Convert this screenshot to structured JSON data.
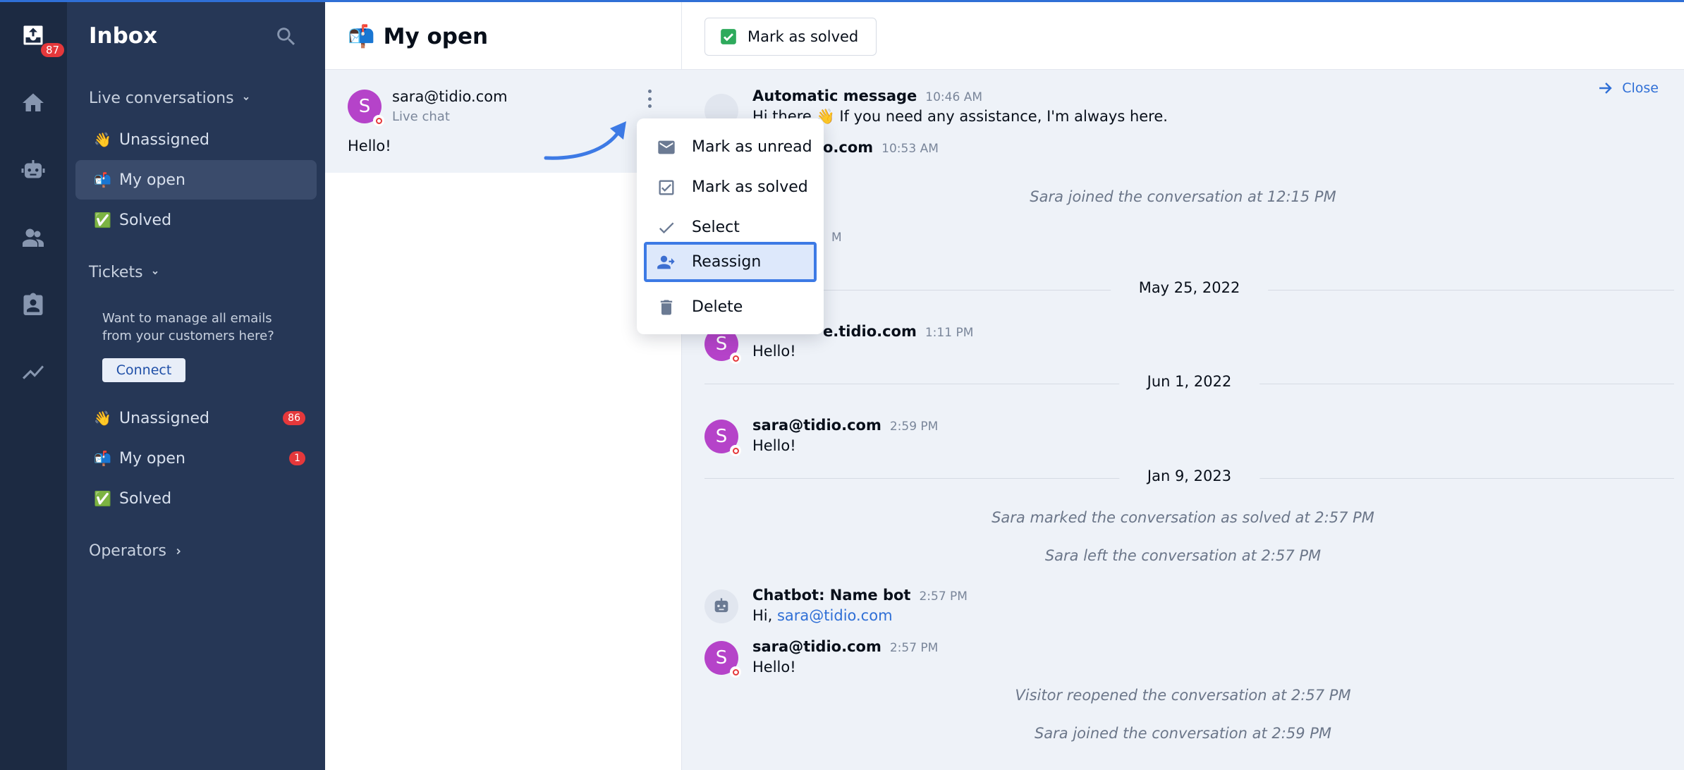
{
  "rail": {
    "inbox_badge": "87",
    "icons": [
      "inbox-icon",
      "home-icon",
      "bot-icon",
      "contacts-icon",
      "tickets-icon",
      "analytics-icon"
    ]
  },
  "sidebar": {
    "title": "Inbox",
    "live_section": "Live conversations",
    "live_items": [
      {
        "emoji": "👋",
        "label": "Unassigned"
      },
      {
        "emoji": "📬",
        "label": "My open"
      },
      {
        "emoji": "✅",
        "label": "Solved"
      }
    ],
    "tickets_section": "Tickets",
    "promo_text": "Want to manage all emails from your customers here?",
    "connect_label": "Connect",
    "ticket_items": [
      {
        "emoji": "👋",
        "label": "Unassigned",
        "count": "86"
      },
      {
        "emoji": "📬",
        "label": "My open",
        "count": "1"
      },
      {
        "emoji": "✅",
        "label": "Solved"
      }
    ],
    "operators_section": "Operators"
  },
  "list": {
    "title": "My open",
    "title_emoji": "📬",
    "conversation": {
      "avatar_letter": "S",
      "email": "sara@tidio.com",
      "channel": "Live chat",
      "preview": "Hello!"
    }
  },
  "menu": {
    "items": [
      {
        "label": "Mark as unread",
        "icon": "mail-icon"
      },
      {
        "label": "Mark as solved",
        "icon": "check-box-icon"
      },
      {
        "label": "Select",
        "icon": "check-icon"
      },
      {
        "label": "Reassign",
        "icon": "reassign-icon"
      },
      {
        "label": "Delete",
        "icon": "trash-icon"
      }
    ]
  },
  "chat": {
    "toolbar": {
      "solve_label": "Mark as solved"
    },
    "close_label": "Close",
    "messages": [
      {
        "name": "Automatic message",
        "time": "10:46 AM",
        "text": "Hi there 👋 If you need any assistance, I'm always here."
      },
      {
        "name": "o.com",
        "time": "10:53 AM"
      },
      {
        "time": "M"
      },
      {
        "name": "e.tidio.com",
        "time": "1:11 PM",
        "text": "Hello!"
      },
      {
        "name": "sara@tidio.com",
        "time": "2:59 PM",
        "text": "Hello!"
      },
      {
        "name": "Chatbot: Name bot",
        "time": "2:57 PM",
        "text_prefix": "Hi, ",
        "link": "sara@tidio.com"
      },
      {
        "name": "sara@tidio.com",
        "time": "2:57 PM",
        "text": "Hello!"
      }
    ],
    "system": [
      "Sara joined the conversation at 12:15 PM",
      "Sara marked the conversation as solved at 2:57 PM",
      "Sara left the conversation at 2:57 PM",
      "Visitor reopened the conversation at 2:57 PM",
      "Sara joined the conversation at 2:59 PM"
    ],
    "dates": [
      "May 25, 2022",
      "Jun 1, 2022",
      "Jan 9, 2023"
    ],
    "avatar_letter": "S"
  },
  "colors": {
    "accent": "#2f6fd6",
    "rail": "#1c2a42",
    "sidebar": "#263756",
    "badge": "#e5383b",
    "avatar": "#b543c9"
  }
}
